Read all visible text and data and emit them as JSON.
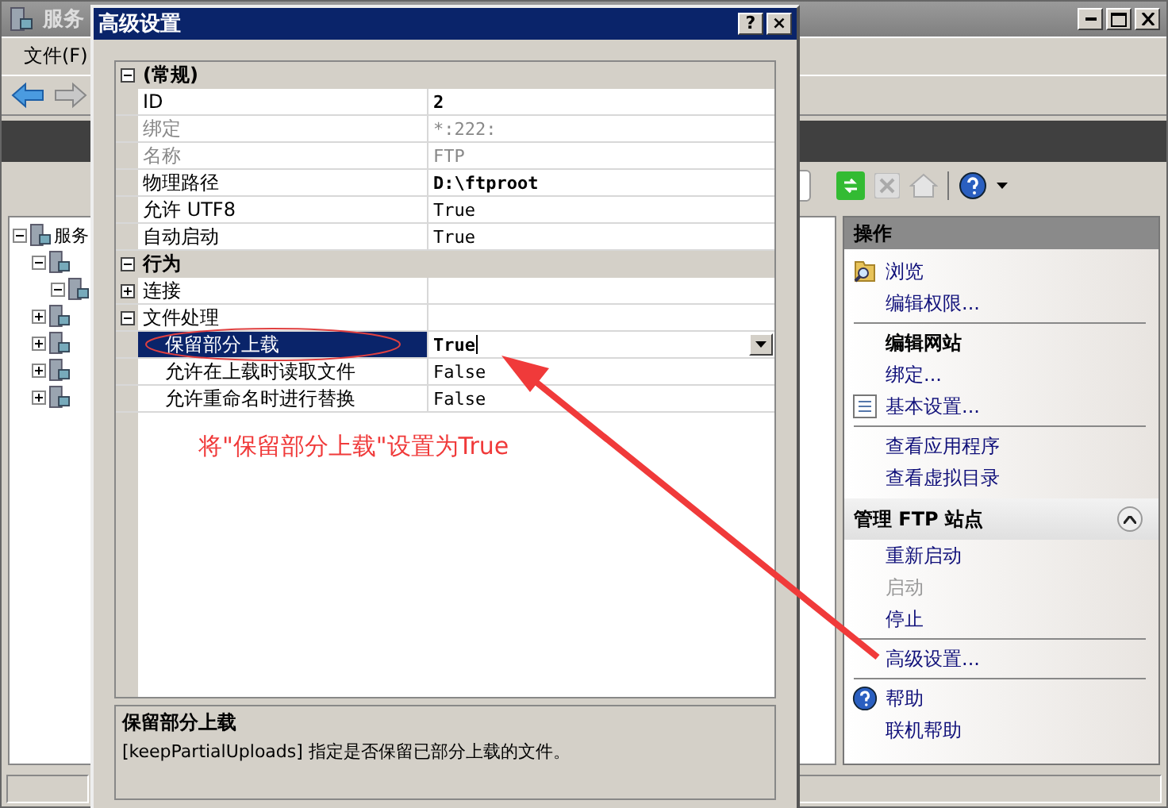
{
  "background_window": {
    "title": "服务",
    "menu": [
      "文件(F)"
    ],
    "tree": [
      {
        "label": "服务",
        "expanded": true,
        "children": [
          {
            "expanded": true,
            "children": [
              {
                "expanded": true
              }
            ]
          },
          {
            "expanded": false
          },
          {
            "expanded": false
          },
          {
            "expanded": false
          },
          {
            "expanded": false
          }
        ]
      }
    ],
    "actions": {
      "title": "操作",
      "items": [
        {
          "kind": "link",
          "label": "浏览",
          "disabled": false
        },
        {
          "kind": "link",
          "label": "编辑权限...",
          "disabled": false
        },
        {
          "kind": "separator"
        },
        {
          "kind": "heading",
          "label": "编辑网站"
        },
        {
          "kind": "link",
          "label": "绑定...",
          "disabled": false
        },
        {
          "kind": "link",
          "label": "基本设置...",
          "disabled": false
        },
        {
          "kind": "separator"
        },
        {
          "kind": "link",
          "label": "查看应用程序",
          "disabled": false
        },
        {
          "kind": "link",
          "label": "查看虚拟目录",
          "disabled": false
        },
        {
          "kind": "section",
          "label": "管理 FTP 站点",
          "expanded": true
        },
        {
          "kind": "link",
          "label": "重新启动",
          "disabled": false
        },
        {
          "kind": "link",
          "label": "启动",
          "disabled": true
        },
        {
          "kind": "link",
          "label": "停止",
          "disabled": false
        },
        {
          "kind": "separator"
        },
        {
          "kind": "link",
          "label": "高级设置...",
          "disabled": false
        },
        {
          "kind": "separator"
        },
        {
          "kind": "link",
          "label": "帮助",
          "disabled": false
        },
        {
          "kind": "link",
          "label": "联机帮助",
          "disabled": false
        }
      ]
    }
  },
  "dialog": {
    "title": "高级设置",
    "buttons": [
      "?",
      "×"
    ],
    "groups": [
      {
        "label": "(常规)",
        "expanded": true,
        "properties": [
          {
            "name": "ID",
            "value": "2",
            "modified": true,
            "readonly": false,
            "selected": false
          },
          {
            "name": "绑定",
            "value": "*:222:",
            "modified": false,
            "readonly": true,
            "selected": false
          },
          {
            "name": "名称",
            "value": "FTP",
            "modified": false,
            "readonly": true,
            "selected": false
          },
          {
            "name": "物理路径",
            "value": "D:\\ftproot",
            "modified": true,
            "readonly": false,
            "selected": false
          },
          {
            "name": "允许 UTF8",
            "value": "True",
            "modified": false,
            "readonly": false,
            "selected": false
          },
          {
            "name": "自动启动",
            "value": "True",
            "modified": false,
            "readonly": false,
            "selected": false
          }
        ]
      },
      {
        "label": "行为",
        "expanded": true,
        "properties": [
          {
            "name": "连接",
            "expanded": false,
            "readonly": false,
            "selected": false
          },
          {
            "name": "文件处理",
            "expanded": true,
            "readonly": false,
            "selected": false,
            "children": [
              {
                "name": "保留部分上载",
                "value": "True",
                "modified": true,
                "readonly": false,
                "selected": true
              },
              {
                "name": "允许在上载时读取文件",
                "value": "False",
                "modified": false,
                "readonly": false,
                "selected": false
              },
              {
                "name": "允许重命名时进行替换",
                "value": "False",
                "modified": false,
                "readonly": false,
                "selected": false
              }
            ]
          }
        ]
      }
    ],
    "description": {
      "title": "保留部分上载",
      "text": "[keepPartialUploads] 指定是否保留已部分上载的文件。"
    }
  },
  "annotation": {
    "text": "将\"保留部分上载\"设置为True"
  }
}
